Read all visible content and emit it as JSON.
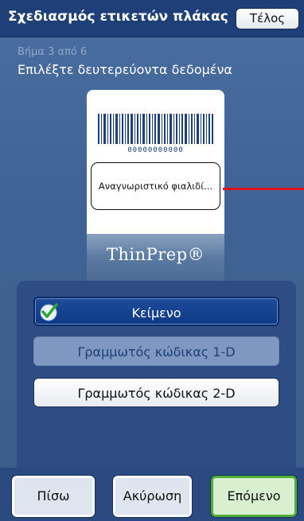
{
  "header": {
    "title": "Σχεδιασμός ετικετών πλάκας",
    "done_label": "Τέλος"
  },
  "wizard": {
    "step": "Βήμα 3 από 6",
    "title": "Επιλέξτε δευτερεύοντα δεδομένα"
  },
  "label_preview": {
    "barcode_digits": "00000000000",
    "field_text": "Αναγνωριστικό φιαλιδί...",
    "brand": "ThinPrep®"
  },
  "options": [
    {
      "label": "Κείμενο",
      "selected": true
    },
    {
      "label": "Γραμμωτός κώδικας 1-D",
      "selected": false,
      "disabled": true
    },
    {
      "label": "Γραμμωτός κώδικας 2-D",
      "selected": false
    }
  ],
  "footer": {
    "back_label": "Πίσω",
    "cancel_label": "Ακύρωση",
    "next_label": "Επόμενο"
  },
  "colors": {
    "header_bg": "#1e3f78",
    "background": "#3f6394",
    "selected_option": "#0d3a86",
    "pointer_line": "#e0101a",
    "next_border": "#4fae3a"
  },
  "icons": {
    "selected_marker": "check-icon"
  }
}
